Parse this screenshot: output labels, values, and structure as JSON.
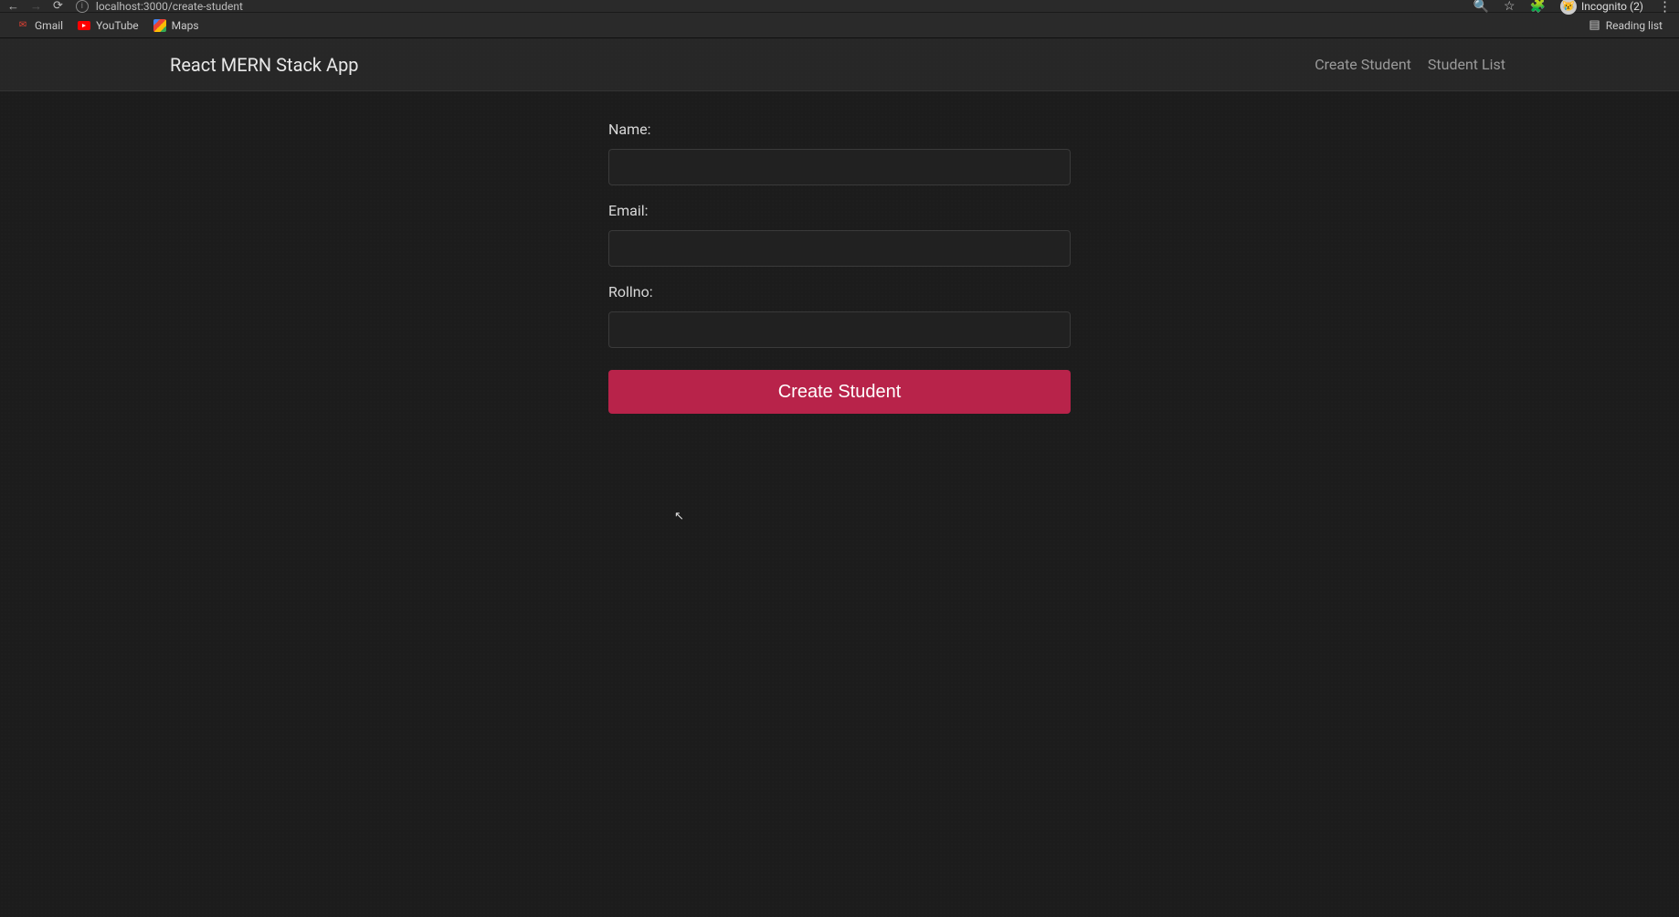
{
  "browser": {
    "url": "localhost:3000/create-student",
    "incognito_label": "Incognito (2)"
  },
  "bookmarks": {
    "gmail": "Gmail",
    "youtube": "YouTube",
    "maps": "Maps",
    "reading_list": "Reading list"
  },
  "app": {
    "title": "React MERN Stack App",
    "nav": {
      "create_student": "Create Student",
      "student_list": "Student List"
    }
  },
  "form": {
    "name_label": "Name:",
    "name_value": "",
    "email_label": "Email:",
    "email_value": "",
    "rollno_label": "Rollno:",
    "rollno_value": "",
    "submit_label": "Create Student"
  }
}
